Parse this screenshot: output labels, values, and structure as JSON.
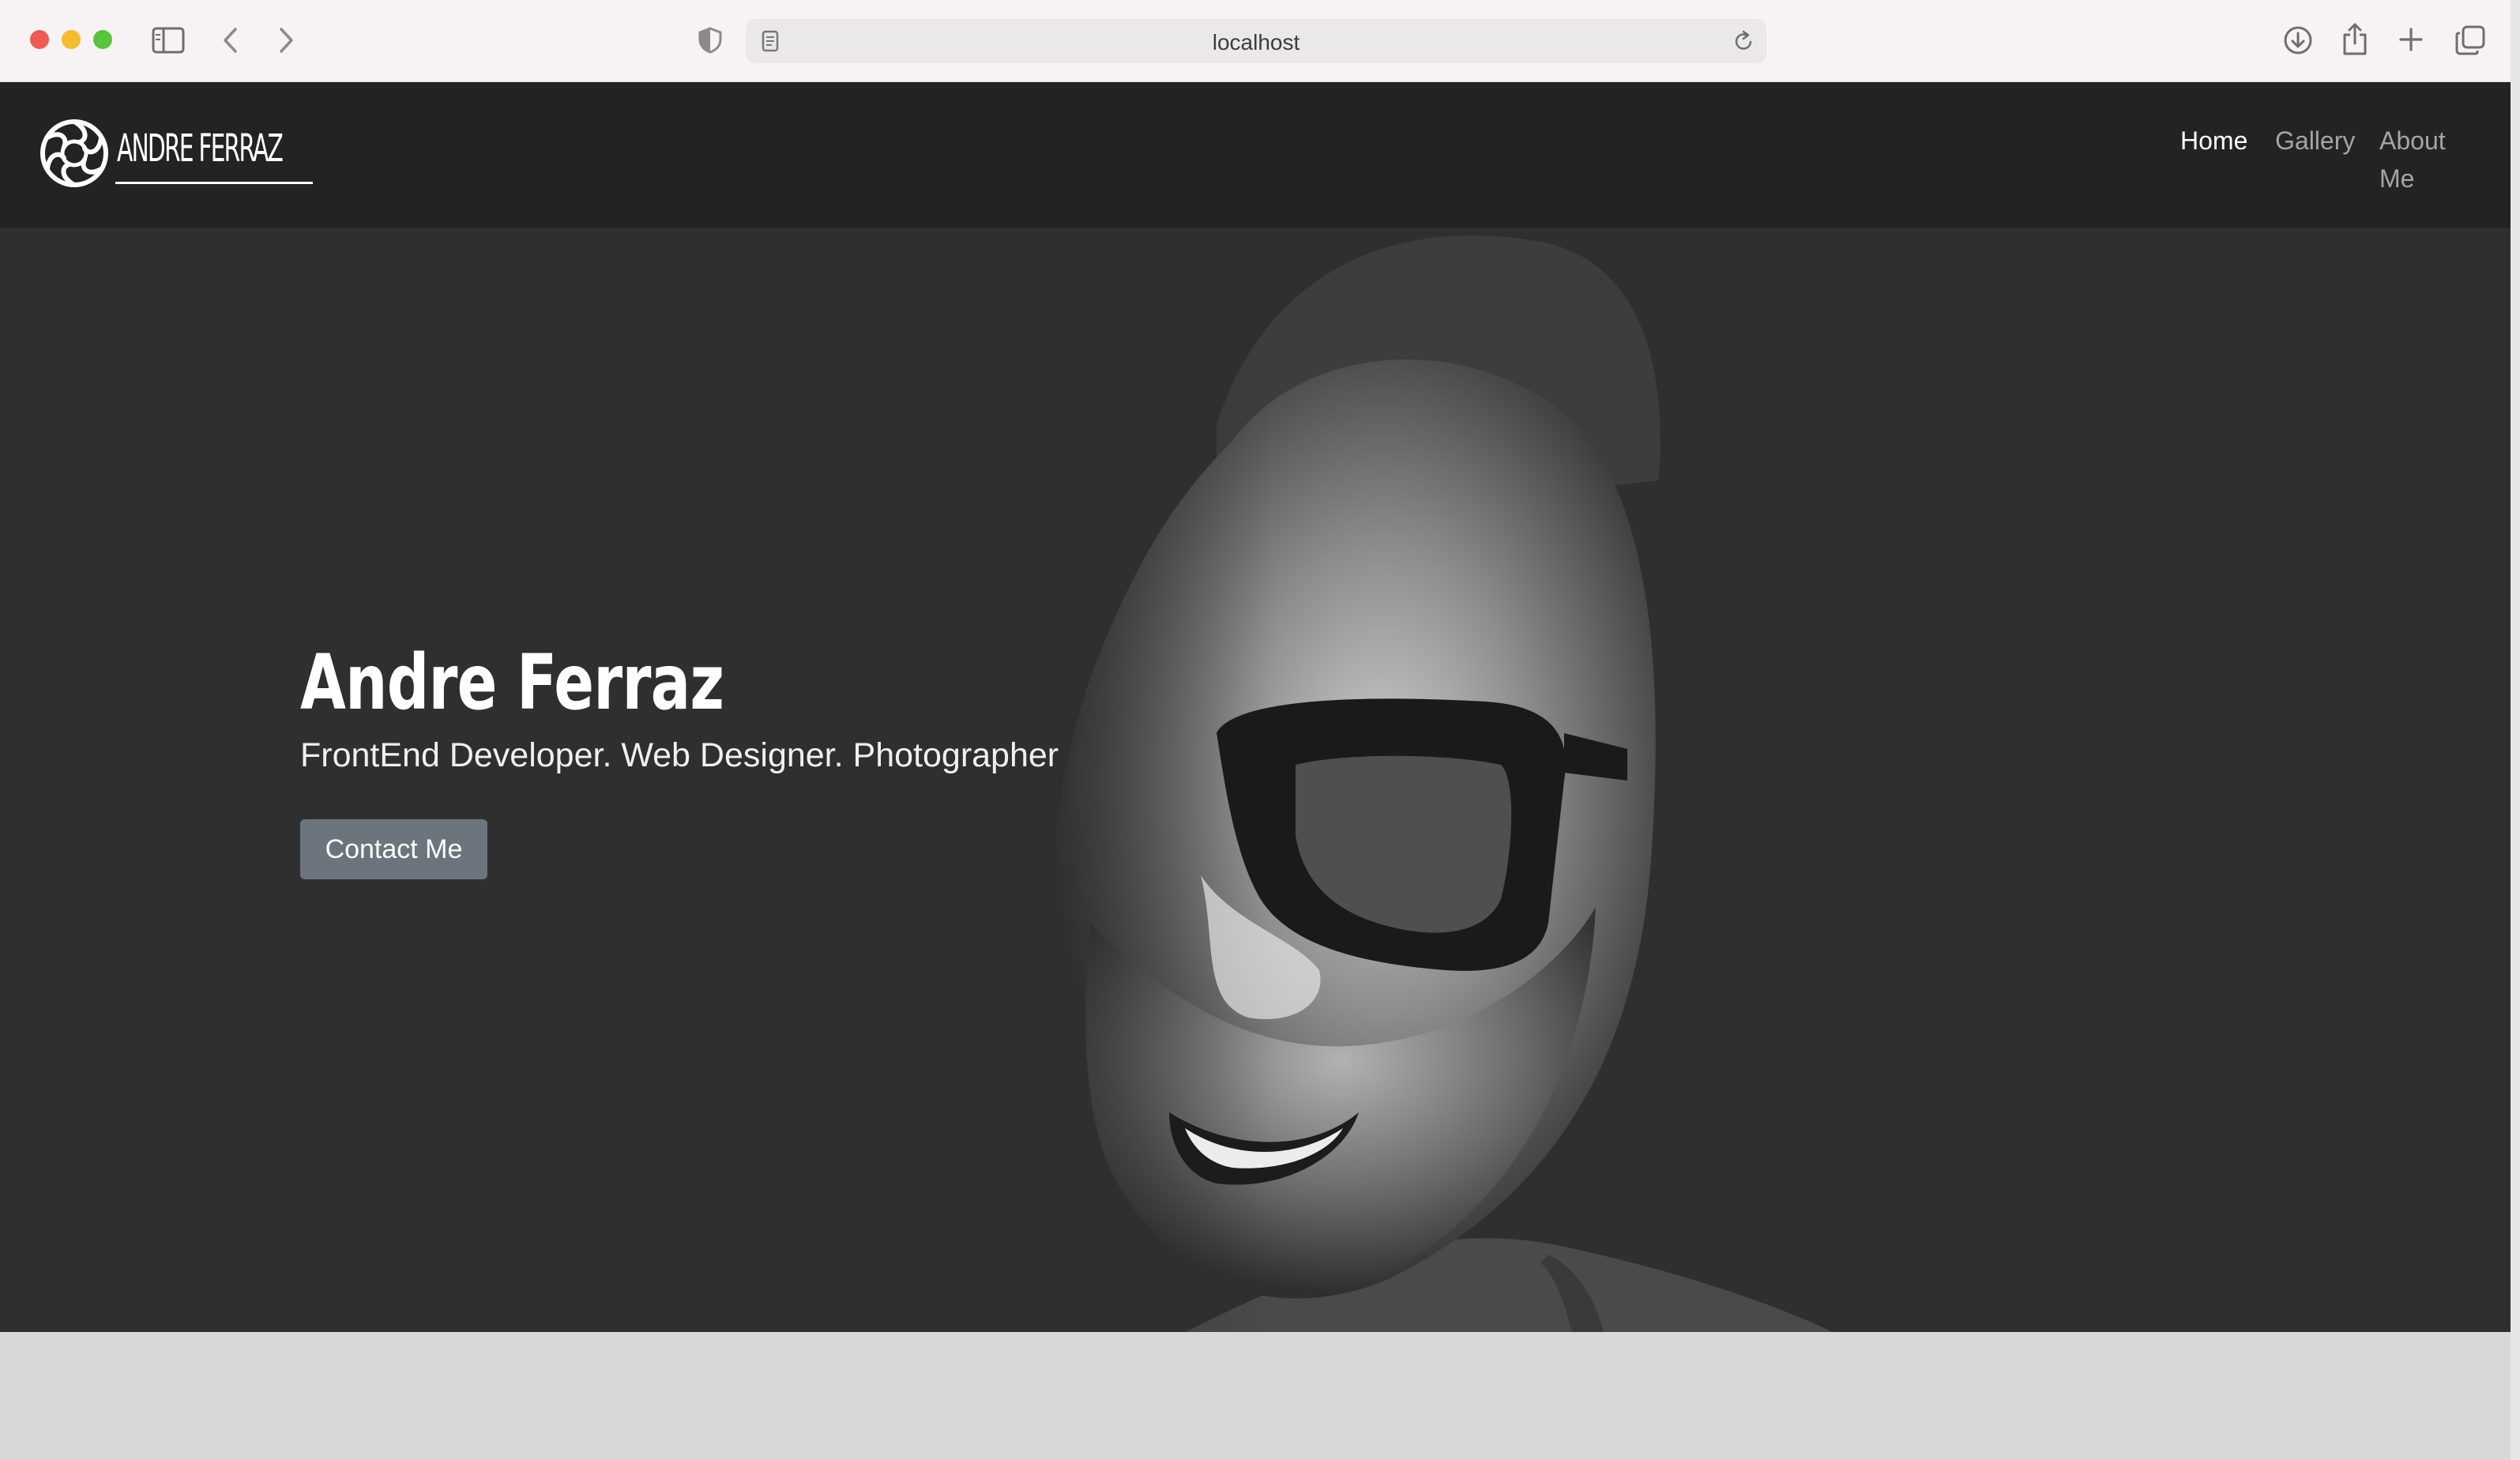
{
  "browser": {
    "url": "localhost",
    "icons": [
      "sidebar-icon",
      "back-icon",
      "forward-icon",
      "shield-icon",
      "page-icon",
      "reload-icon",
      "download-icon",
      "share-icon",
      "new-tab-icon",
      "tabs-overview-icon"
    ]
  },
  "site": {
    "logo_text": "ANDRE FERRAZ",
    "nav": {
      "home": "Home",
      "gallery": "Gallery",
      "about": "About Me",
      "active": "Home"
    }
  },
  "hero": {
    "title": "Andre Ferraz",
    "subtitle": "FrontEnd Developer. Web Designer. Photographer",
    "cta": "Contact Me"
  },
  "colors": {
    "navbar": "#232323",
    "hero_bg": "#2f2f2f",
    "button": "#6c757d",
    "page_bg": "#d8d8d8"
  }
}
